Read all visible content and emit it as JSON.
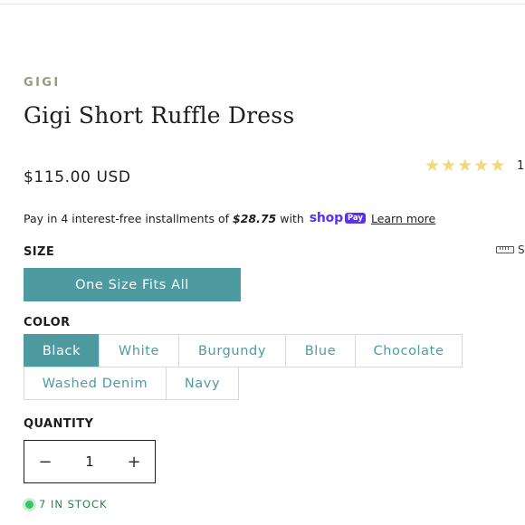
{
  "product": {
    "brand": "GIGI",
    "title": "Gigi Short Ruffle Dress",
    "price": "$115.00 USD",
    "rating_stars": 5,
    "review_count": "1"
  },
  "installments": {
    "prefix": "Pay in 4 interest-free installments of",
    "amount": "$28.75",
    "with": "with",
    "shop_logo": "shop",
    "pay_badge": "Pay",
    "learn_more": "Learn more"
  },
  "size": {
    "label": "SIZE",
    "size_guide_label": "S",
    "options": [
      "One Size Fits All"
    ],
    "selected": "One Size Fits All"
  },
  "color": {
    "label": "COLOR",
    "options": [
      "Black",
      "White",
      "Burgundy",
      "Blue",
      "Chocolate",
      "Washed Denim",
      "Navy"
    ],
    "selected": "Black"
  },
  "quantity": {
    "label": "QUANTITY",
    "value": "1",
    "minus": "−",
    "plus": "+"
  },
  "stock": {
    "text": "7 IN STOCK"
  },
  "colors": {
    "accent": "#4d9aa1",
    "shop_pay": "#5a31f4",
    "star": "#f3d77a",
    "stock_green": "#3ac46a"
  }
}
